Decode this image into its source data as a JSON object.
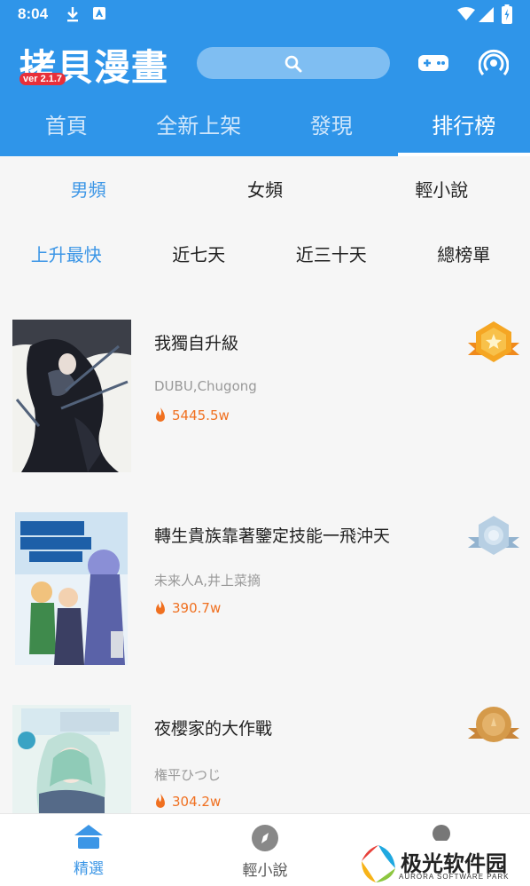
{
  "statusbar": {
    "time": "8:04"
  },
  "header": {
    "logo": "拷貝漫畫",
    "version": "ver 2.1.7",
    "tabs": [
      "首頁",
      "全新上架",
      "發現",
      "排行榜"
    ],
    "active_tab": 3
  },
  "categories": [
    "男頻",
    "女頻",
    "輕小說"
  ],
  "periods": [
    "上升最快",
    "近七天",
    "近三十天",
    "總榜單"
  ],
  "items": [
    {
      "title": "我獨自升級",
      "author": "DUBU,Chugong",
      "heat": "5445.5w",
      "medal": "gold",
      "medal_color": "#f5a623"
    },
    {
      "title": "轉生貴族靠著鑒定技能一飛沖天",
      "author": "未来人A,井上菜摘",
      "heat": "390.7w",
      "medal": "silver",
      "medal_color": "#9fbfd9"
    },
    {
      "title": "夜櫻家的大作戰",
      "author": "権平ひつじ",
      "heat": "304.2w",
      "medal": "bronze",
      "medal_color": "#d59a4a"
    }
  ],
  "bottomnav": {
    "items": [
      "精選",
      "輕小說"
    ]
  },
  "watermark": {
    "name": "极光软件园",
    "sub": "AURORA SOFTWARE PARK"
  },
  "colors": {
    "primary": "#2f95e9",
    "accent_text": "#3c96e6",
    "heat": "#f07020"
  }
}
